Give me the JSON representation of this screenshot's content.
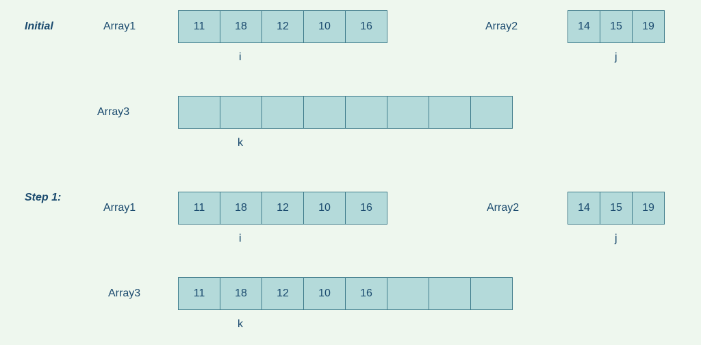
{
  "initial": {
    "label": "Initial",
    "array1": {
      "label": "Array1",
      "values": [
        "11",
        "18",
        "12",
        "10",
        "16"
      ],
      "pointer": "i"
    },
    "array2": {
      "label": "Array2",
      "values": [
        "14",
        "15",
        "19"
      ],
      "pointer": "j"
    },
    "array3": {
      "label": "Array3",
      "cells": 8,
      "values": [
        "",
        "",
        "",
        "",
        "",
        "",
        "",
        ""
      ],
      "pointer": "k"
    }
  },
  "step1": {
    "label": "Step 1:",
    "array1": {
      "label": "Array1",
      "values": [
        "11",
        "18",
        "12",
        "10",
        "16"
      ],
      "pointer": "i"
    },
    "array2": {
      "label": "Array2",
      "values": [
        "14",
        "15",
        "19"
      ],
      "pointer": "j"
    },
    "array3": {
      "label": "Array3",
      "cells": 8,
      "values": [
        "11",
        "18",
        "12",
        "10",
        "16",
        "",
        "",
        ""
      ],
      "pointer": "k"
    }
  }
}
